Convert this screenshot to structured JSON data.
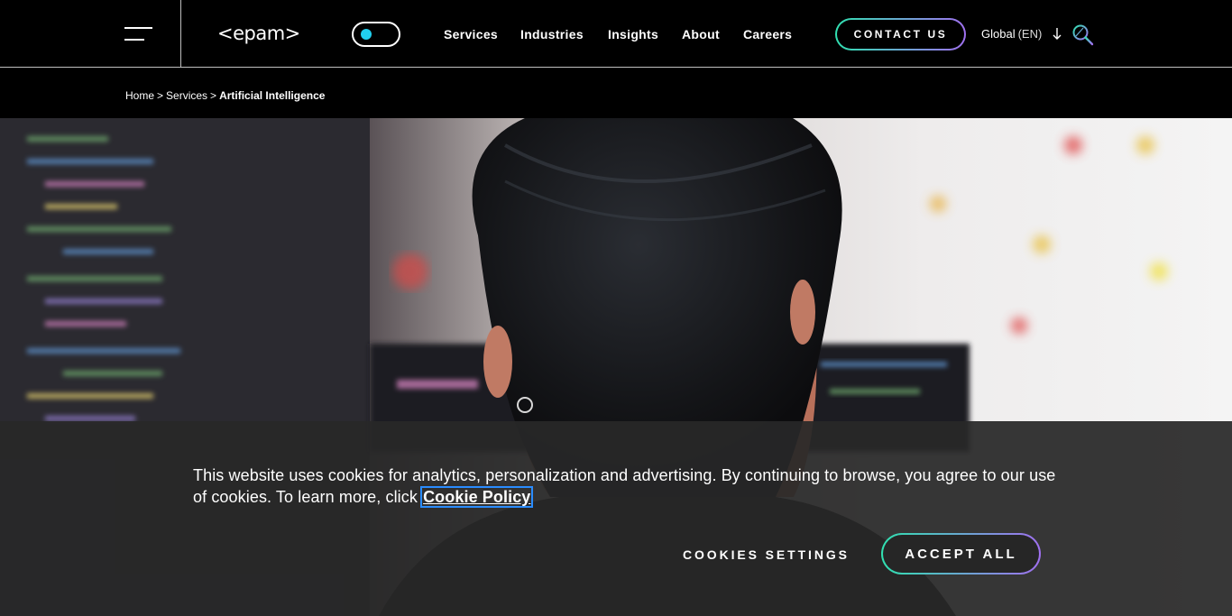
{
  "header": {
    "logo_text": "<epam>",
    "nav": [
      "Services",
      "Industries",
      "Insights",
      "About",
      "Careers"
    ],
    "contact_label": "CONTACT US",
    "locale_label": "Global",
    "locale_code": "(EN)",
    "icons": {
      "menu": "hamburger-icon",
      "theme": "theme-toggle-icon",
      "locale": "arrow-down-icon",
      "search": "search-icon"
    },
    "colors": {
      "accent_start": "#30e0b0",
      "accent_end": "#a070f0",
      "toggle_knob": "#21d0f0"
    }
  },
  "breadcrumb": {
    "home": "Home",
    "separator": ">",
    "services": "Services",
    "current": "Artificial Intelligence"
  },
  "hero": {
    "image": "photo of a person with dark hair facing computer monitors showing code"
  },
  "cookie_banner": {
    "text": "This website uses cookies for analytics, personalization and advertising. By continuing to browse, you agree to our use of cookies. To learn more, click ",
    "link_label": "Cookie Policy",
    "settings_label": "COOKIES SETTINGS",
    "accept_label": "ACCEPT ALL"
  }
}
